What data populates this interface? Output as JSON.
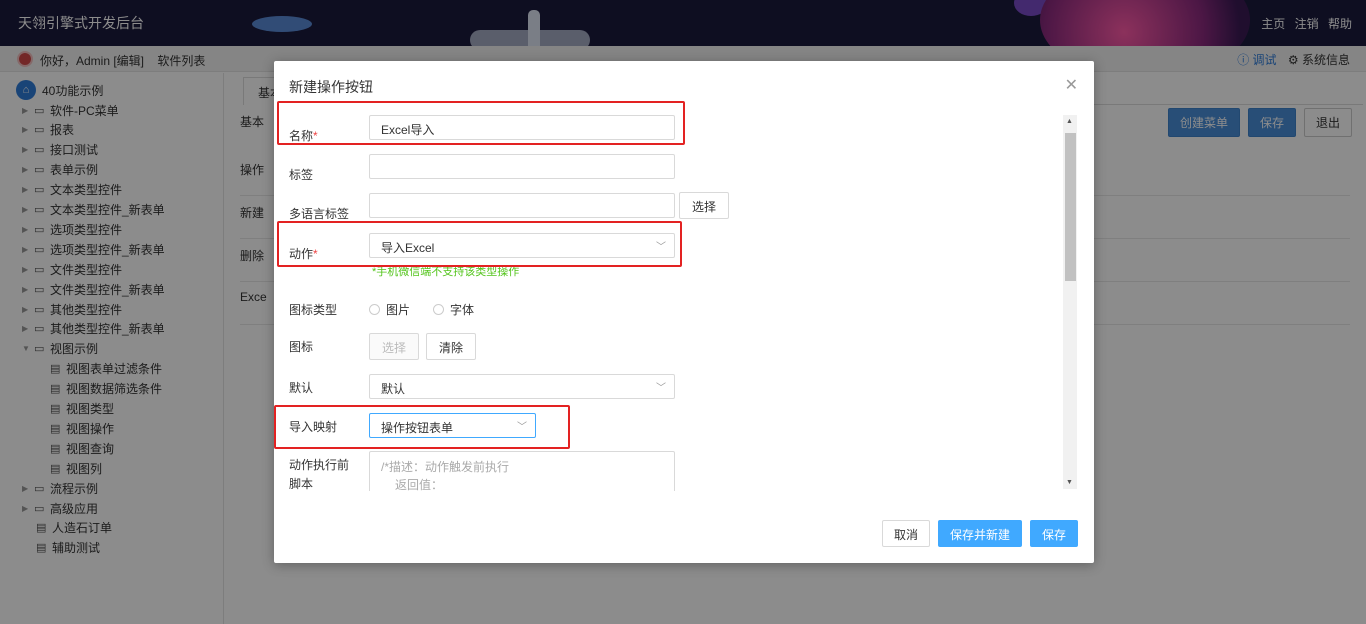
{
  "header": {
    "title": "天翎引擎式开发后台",
    "links": [
      "主页",
      "注销",
      "帮助"
    ]
  },
  "subbar": {
    "greeting": "你好，Admin [编辑]",
    "software_list": "软件列表",
    "debug": "ⓘ 调试",
    "sysinfo": "⚙ 系统信息"
  },
  "sidebar": {
    "root": "40功能示例",
    "items": [
      {
        "label": "软件-PC菜单",
        "type": "folder"
      },
      {
        "label": "报表",
        "type": "folder"
      },
      {
        "label": "接口测试",
        "type": "folder"
      },
      {
        "label": "表单示例",
        "type": "folder"
      },
      {
        "label": "文本类型控件",
        "type": "folder"
      },
      {
        "label": "文本类型控件_新表单",
        "type": "folder"
      },
      {
        "label": "选项类型控件",
        "type": "folder"
      },
      {
        "label": "选项类型控件_新表单",
        "type": "folder"
      },
      {
        "label": "文件类型控件",
        "type": "folder"
      },
      {
        "label": "文件类型控件_新表单",
        "type": "folder"
      },
      {
        "label": "其他类型控件",
        "type": "folder"
      },
      {
        "label": "其他类型控件_新表单",
        "type": "folder"
      },
      {
        "label": "视图示例",
        "type": "folder-open"
      },
      {
        "label": "视图表单过滤条件",
        "type": "file"
      },
      {
        "label": "视图数据筛选条件",
        "type": "file"
      },
      {
        "label": "视图类型",
        "type": "file"
      },
      {
        "label": "视图操作",
        "type": "file"
      },
      {
        "label": "视图查询",
        "type": "file"
      },
      {
        "label": "视图列",
        "type": "file"
      },
      {
        "label": "流程示例",
        "type": "folder"
      },
      {
        "label": "高级应用",
        "type": "folder"
      },
      {
        "label": "人造石订单",
        "type": "file-root"
      },
      {
        "label": "辅助测试",
        "type": "file-root"
      }
    ]
  },
  "main": {
    "tab": "基本",
    "basic_label": "基本",
    "buttons": {
      "create_menu": "创建菜单",
      "save": "保存",
      "exit": "退出"
    },
    "rows": [
      "操作",
      "新建",
      "删除",
      "Exce"
    ]
  },
  "dialog": {
    "title": "新建操作按钮",
    "fields": {
      "name": {
        "label": "名称",
        "value": "Excel导入"
      },
      "tag": {
        "label": "标签",
        "value": ""
      },
      "i18n_tag": {
        "label": "多语言标签",
        "value": "",
        "button": "选择"
      },
      "action": {
        "label": "动作",
        "value": "导入Excel",
        "hint": "手机微信端不支持该类型操作"
      },
      "icon_type": {
        "label": "图标类型",
        "options": [
          "图片",
          "字体"
        ]
      },
      "icon": {
        "label": "图标",
        "select": "选择",
        "clear": "清除"
      },
      "default": {
        "label": "默认",
        "value": "默认"
      },
      "import_mapping": {
        "label": "导入映射",
        "value": "操作按钮表单"
      },
      "pre_script": {
        "label_line1": "动作执行前",
        "label_line2": "脚本",
        "line1": "/*描述：动作触发前执行",
        "line2": "  返回值："
      }
    },
    "footer": {
      "cancel": "取消",
      "save_new": "保存并新建",
      "save": "保存"
    }
  }
}
